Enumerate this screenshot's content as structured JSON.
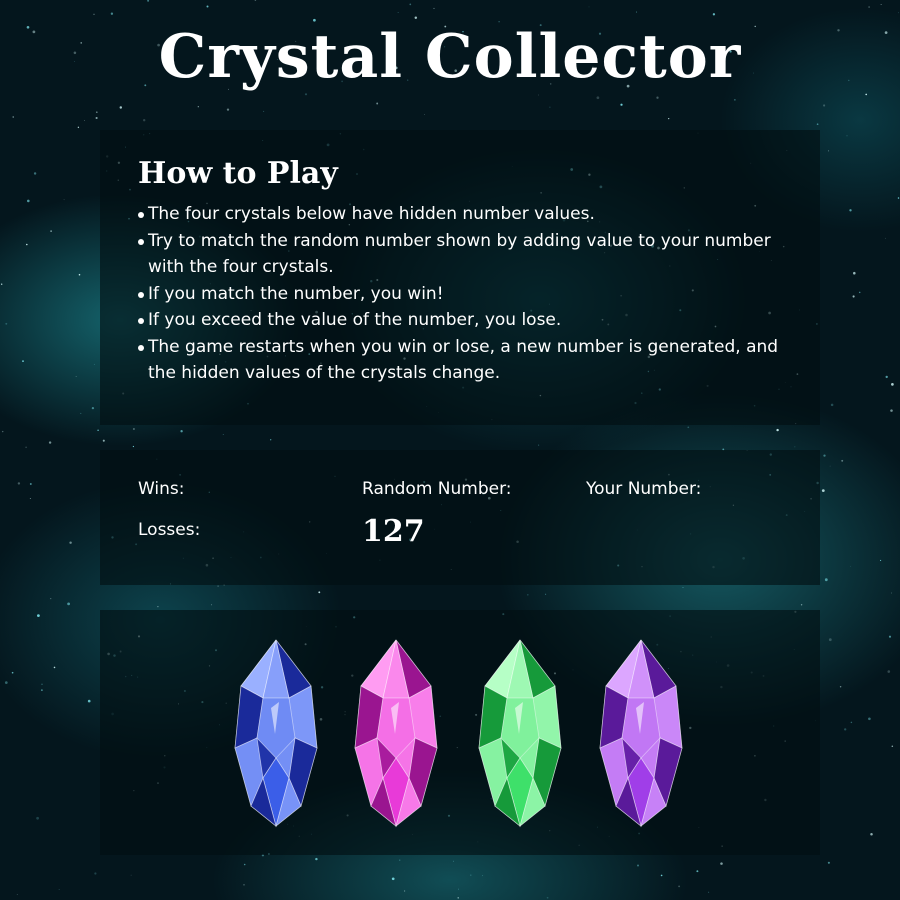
{
  "page": {
    "title": "Crystal Collector"
  },
  "instructions": {
    "heading": "How to Play",
    "items": [
      "The four crystals below have hidden number values.",
      "Try to match the random number shown by adding value to your number with the four crystals.",
      "If you match the number, you win!",
      "If you exceed the value of the number, you lose.",
      "The game restarts when you win or lose, a new number is generated, and the hidden values of the crystals change."
    ]
  },
  "scoreboard": {
    "wins_label": "Wins:",
    "wins_value": "",
    "losses_label": "Losses:",
    "losses_value": "",
    "random_label": "Random Number:",
    "random_value": "127",
    "your_label": "Your Number:",
    "your_value": ""
  },
  "crystals": [
    {
      "name": "blue-crystal",
      "color": "#3b5ee8",
      "light": "#9ab0ff",
      "dark": "#1a2a9a"
    },
    {
      "name": "pink-crystal",
      "color": "#e83ad8",
      "light": "#ff9cf2",
      "dark": "#9a1590"
    },
    {
      "name": "green-crystal",
      "color": "#3ee06a",
      "light": "#b6ffc6",
      "dark": "#169a3a"
    },
    {
      "name": "purple-crystal",
      "color": "#a03ee8",
      "light": "#dca6ff",
      "dark": "#5a1a9a"
    }
  ],
  "colors": {
    "background": "#04161d",
    "nebula": "#2ab6c2",
    "panel": "rgba(2,14,18,0.62)",
    "text": "#ffffff"
  }
}
